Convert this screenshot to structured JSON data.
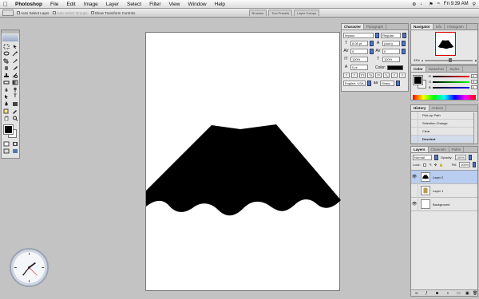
{
  "menubar": {
    "apple": "",
    "items": [
      "Photoshop",
      "File",
      "Edit",
      "Image",
      "Layer",
      "Select",
      "Filter",
      "View",
      "Window",
      "Help"
    ],
    "clock": "Fri 9:39 AM",
    "lang": "US"
  },
  "options": {
    "auto_select_layer": "Auto Select Layer",
    "auto_select_groups": "Auto Select Groups",
    "show_transform": "Show Transform Controls",
    "well_tabs": [
      "Brushes",
      "Tool Presets",
      "Layer Comps"
    ]
  },
  "character": {
    "tabs": [
      "Character",
      "Paragraph"
    ],
    "font_family": "Impact",
    "font_style": "Regular",
    "font_size": "8.08 pt",
    "leading": "(Auto)",
    "tracking": "0",
    "kerning": "0",
    "vscale": "100%",
    "hscale": "100%",
    "baseline": "0 pt",
    "color_label": "Color:",
    "language": "English: USA",
    "antialias": "Sharp"
  },
  "navigator": {
    "tabs": [
      "Navigator",
      "Info",
      "Histogram"
    ],
    "zoom": "33%"
  },
  "color_panel": {
    "tabs": [
      "Color",
      "Swatches",
      "Styles"
    ],
    "channels": [
      {
        "label": "R",
        "value": "0"
      },
      {
        "label": "G",
        "value": "0"
      },
      {
        "label": "B",
        "value": "0"
      }
    ]
  },
  "history": {
    "tabs": [
      "History",
      "Actions"
    ],
    "items": [
      "Pick-up Path",
      "Selection Change",
      "Clear",
      "Deselect"
    ],
    "selected": 3
  },
  "layers": {
    "tabs": [
      "Layers",
      "Channels",
      "Paths"
    ],
    "blend_mode": "Normal",
    "opacity_label": "Opacity:",
    "opacity": "100%",
    "lock_label": "Lock:",
    "fill_label": "Fill:",
    "fill": "100%",
    "items": [
      {
        "name": "Layer 2",
        "selected": true
      },
      {
        "name": "Layer 1",
        "selected": false
      },
      {
        "name": "Background",
        "selected": false
      }
    ]
  },
  "colors": {
    "foreground": "#000000",
    "background": "#ffffff",
    "selection_blue": "#b8cdf0"
  }
}
